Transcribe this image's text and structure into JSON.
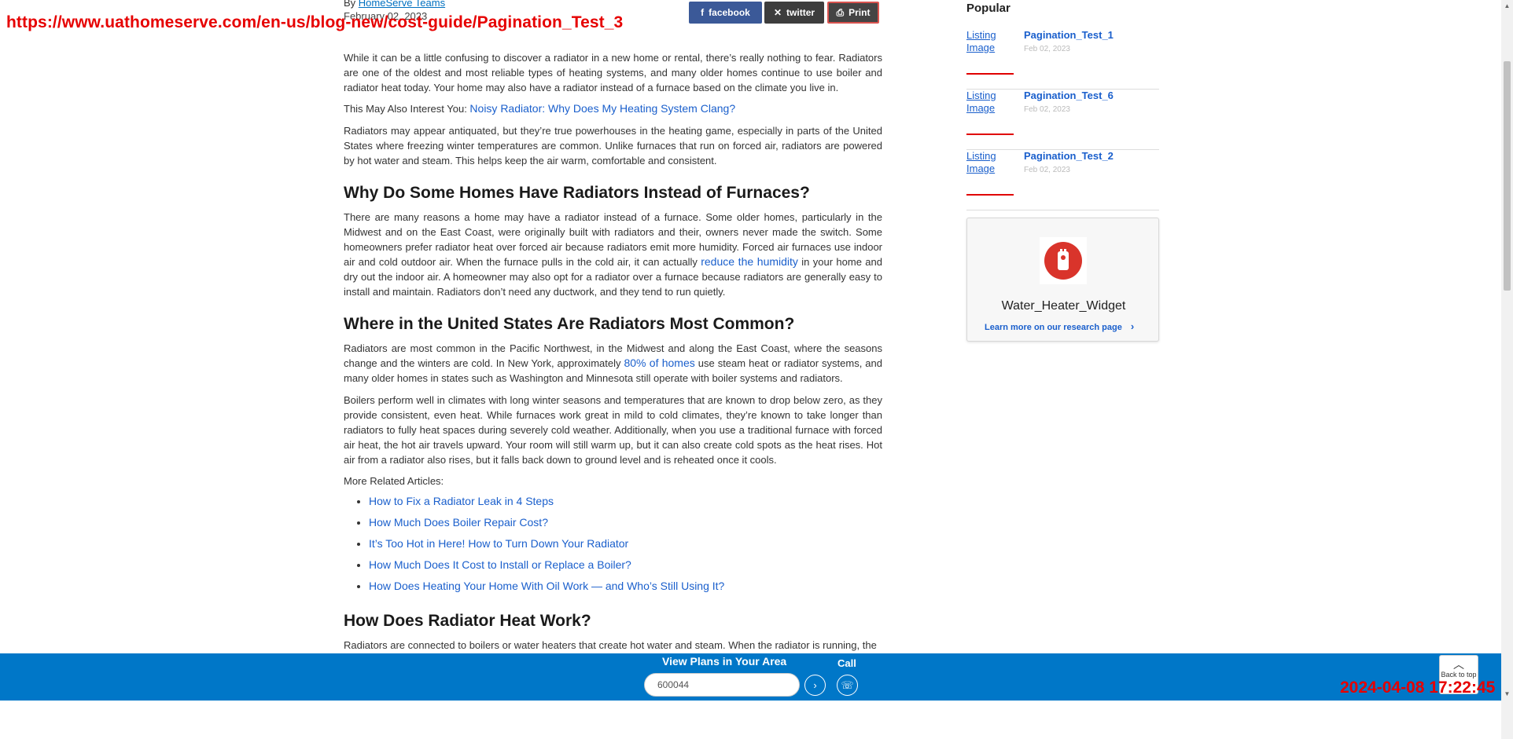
{
  "overlay": {
    "url": "https://www.uathomeserve.com/en-us/blog-new/cost-guide/Pagination_Test_3",
    "timestamp": "2024-04-08 17:22:45"
  },
  "article": {
    "byline_prefix": "By ",
    "author": "HomeServe Teams",
    "date": "February 02, 2023",
    "share": {
      "facebook": "facebook",
      "twitter": "twitter",
      "print": "Print"
    },
    "p1": "While it can be a little confusing to discover a radiator in a new home or rental, there’s really nothing to fear. Radiators are one of the oldest and most reliable types of heating systems, and many older homes continue to use boiler and radiator heat today. Your home may also have a radiator instead of a furnace based on the climate you live in.",
    "interest_label": "This May Also Interest You: ",
    "interest_link": "Noisy Radiator: Why Does My Heating System Clang?",
    "p2": "Radiators may appear antiquated, but they’re true powerhouses in the heating game, especially in parts of the United States where freezing winter temperatures are common. Unlike furnaces that run on forced air, radiators are powered by hot water and steam. This helps keep the air warm, comfortable and consistent.",
    "h2a": "Why Do Some Homes Have Radiators Instead of Furnaces?",
    "p3_before": "There are many reasons a home may have a radiator instead of a furnace. Some older homes, particularly in the Midwest and on the East Coast, were originally built with radiators and their, owners never made the switch. Some homeowners prefer radiator heat over forced air because radiators emit more humidity. Forced air furnaces use indoor air and cold outdoor air. When the furnace pulls in the cold air, it can actually ",
    "p3_link": "reduce the humidity",
    "p3_after": " in your home and dry out the indoor air. A homeowner may also opt for a radiator over a furnace because radiators are generally easy to install and maintain. Radiators don’t need any ductwork, and they tend to run quietly.",
    "h2b": "Where in the United States Are Radiators Most Common?",
    "p4_before": "Radiators are most common in the Pacific Northwest, in the Midwest and along the East Coast, where the seasons change and the winters are cold. In New York, approximately ",
    "p4_link": "80% of homes",
    "p4_after": " use steam heat or radiator systems, and many older homes in states such as Washington and Minnesota still operate with boiler systems and radiators.",
    "p5": "Boilers perform well in climates with long winter seasons and temperatures that are known to drop below zero, as they provide consistent, even heat. While furnaces work great in mild to cold climates, they’re known to take longer than radiators to fully heat spaces during severely cold weather. Additionally, when you use a traditional furnace with forced air heat, the hot air travels upward. Your room will still warm up, but it can also create cold spots as the heat rises. Hot air from a radiator also rises, but it falls back down to ground level and is reheated once it cools.",
    "related_label": "More Related Articles:",
    "related": [
      "How to Fix a Radiator Leak in 4 Steps",
      "How Much Does Boiler Repair Cost?",
      "It’s Too Hot in Here! How to Turn Down Your Radiator",
      "How Much Does It Cost to Install or Replace a Boiler?",
      "How Does Heating Your Home With Oil Work — and Who’s Still Using It?"
    ],
    "h2c": "How Does Radiator Heat Work?",
    "p6": "Radiators are connected to boilers or water heaters that create hot water and steam. When the radiator is running, the"
  },
  "sidebar": {
    "popular_title": "Popular",
    "items": [
      {
        "thumb_alt": "Listing Image",
        "title": "Pagination_Test_1",
        "date": "Feb 02, 2023"
      },
      {
        "thumb_alt": "Listing Image",
        "title": "Pagination_Test_6",
        "date": "Feb 02, 2023"
      },
      {
        "thumb_alt": "Listing Image",
        "title": "Pagination_Test_2",
        "date": "Feb 02, 2023"
      }
    ],
    "widget": {
      "title": "Water_Heater_Widget",
      "link": "Learn more on our research page",
      "icon": "water-heater-icon"
    }
  },
  "bottom_bar": {
    "title": "View Plans in Your Area",
    "call_label": "Call",
    "zip_value": "600044",
    "back_to_top": "Back to top"
  },
  "colors": {
    "brand_blue": "#0077c8",
    "link_blue": "#1a5fcc",
    "accent_red": "#e00000",
    "widget_icon_red": "#d9342b"
  }
}
